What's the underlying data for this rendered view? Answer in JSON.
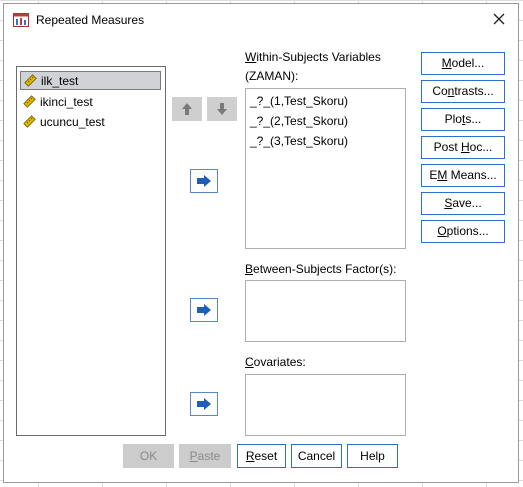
{
  "window": {
    "title": "Repeated Measures",
    "close_glyph": "✕"
  },
  "source_variables": [
    {
      "label": "ilk_test",
      "selected": true,
      "icon": "scale-ruler-icon"
    },
    {
      "label": "ikinci_test",
      "selected": false,
      "icon": "scale-ruler-icon"
    },
    {
      "label": "ucuncu_test",
      "selected": false,
      "icon": "scale-ruler-icon"
    }
  ],
  "within": {
    "label_mnemonic": "W",
    "label_rest": "ithin-Subjects Variables",
    "factor": "(ZAMAN):",
    "rows": [
      "_?_(1,Test_Skoru)",
      "_?_(2,Test_Skoru)",
      "_?_(3,Test_Skoru)"
    ]
  },
  "between": {
    "label_mnemonic": "B",
    "label_rest": "etween-Subjects Factor(s):"
  },
  "covariates": {
    "label_mnemonic": "C",
    "label_rest": "ovariates:"
  },
  "right_buttons": [
    {
      "pre": "",
      "mn": "M",
      "post": "odel..."
    },
    {
      "pre": "Co",
      "mn": "n",
      "post": "trasts..."
    },
    {
      "pre": "Plo",
      "mn": "t",
      "post": "s..."
    },
    {
      "pre": "Post ",
      "mn": "H",
      "post": "oc..."
    },
    {
      "pre": "E",
      "mn": "M",
      "post": " Means..."
    },
    {
      "pre": "",
      "mn": "S",
      "post": "ave..."
    },
    {
      "pre": "",
      "mn": "O",
      "post": "ptions..."
    }
  ],
  "bottom_buttons": [
    {
      "pre": "",
      "mn": "",
      "post": "OK",
      "enabled": false
    },
    {
      "pre": "",
      "mn": "P",
      "post": "aste",
      "enabled": false
    },
    {
      "pre": "",
      "mn": "R",
      "post": "eset",
      "enabled": true
    },
    {
      "pre": "",
      "mn": "",
      "post": "Cancel",
      "enabled": true
    },
    {
      "pre": "",
      "mn": "",
      "post": "Help",
      "enabled": true
    }
  ],
  "colors": {
    "button_border": "#2e6fc9",
    "arrow_fill": "#1f5fb8",
    "disabled_fill": "#cccccc"
  }
}
